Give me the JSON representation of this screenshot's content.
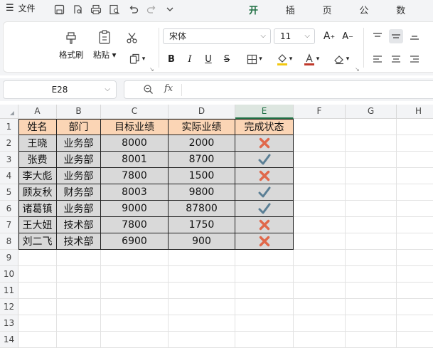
{
  "menu": {
    "file_label": "文件"
  },
  "tabs": [
    {
      "label": "开始",
      "active": true
    },
    {
      "label": "插入",
      "active": false
    },
    {
      "label": "页面",
      "active": false
    },
    {
      "label": "公式",
      "active": false
    },
    {
      "label": "数据",
      "active": false
    }
  ],
  "ribbon": {
    "format_painter_label": "格式刷",
    "paste_label": "粘贴",
    "font_name": "宋体",
    "font_size": "11",
    "bold_label": "B",
    "italic_label": "I",
    "underline_label": "U",
    "strikethrough_label": "S"
  },
  "formula_bar": {
    "name_box": "E28",
    "fx_label": "fx",
    "formula": ""
  },
  "columns": [
    "A",
    "B",
    "C",
    "D",
    "E",
    "F",
    "G",
    "H"
  ],
  "rows": [
    "1",
    "2",
    "3",
    "4",
    "5",
    "6",
    "7",
    "8",
    "9",
    "10",
    "11",
    "12",
    "13",
    "14"
  ],
  "table": {
    "headers": [
      "姓名",
      "部门",
      "目标业绩",
      "实际业绩",
      "完成状态"
    ],
    "rows": [
      {
        "name": "王晓",
        "dept": "业务部",
        "target": "8000",
        "actual": "2000",
        "status": "cross"
      },
      {
        "name": "张费",
        "dept": "业务部",
        "target": "8001",
        "actual": "8700",
        "status": "check"
      },
      {
        "name": "李大彪",
        "dept": "业务部",
        "target": "7800",
        "actual": "1500",
        "status": "cross"
      },
      {
        "name": "顾友秋",
        "dept": "财务部",
        "target": "8003",
        "actual": "9800",
        "status": "check"
      },
      {
        "name": "诸葛镇",
        "dept": "业务部",
        "target": "9000",
        "actual": "87800",
        "status": "check"
      },
      {
        "name": "王大妞",
        "dept": "技术部",
        "target": "7800",
        "actual": "1750",
        "status": "cross"
      },
      {
        "name": "刘二飞",
        "dept": "技术部",
        "target": "6900",
        "actual": "900",
        "status": "cross"
      }
    ]
  },
  "colors": {
    "header_fill": "#fbd5b5",
    "data_fill": "#d9d9d9",
    "check_color": "#5b7f95",
    "cross_color": "#e0684a",
    "accent": "#1f6f43"
  }
}
